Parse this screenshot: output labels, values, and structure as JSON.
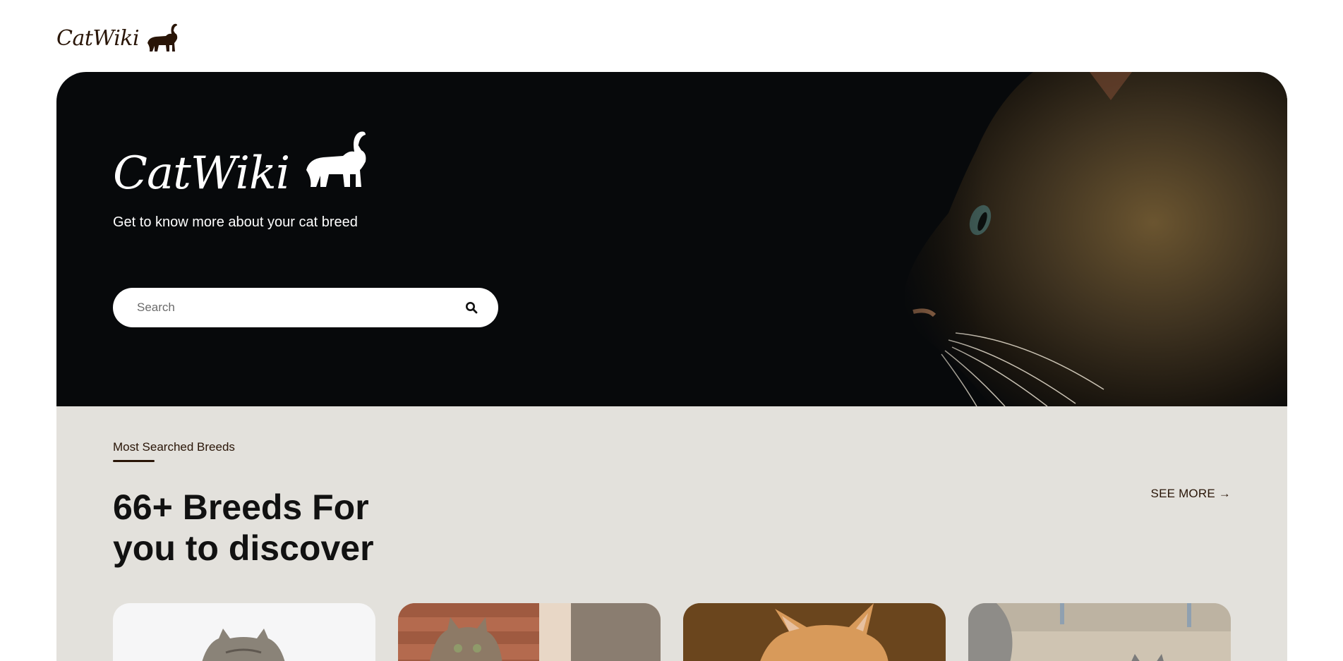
{
  "header": {
    "logo_text": "CatWiki",
    "logo_icon": "cat-silhouette-icon",
    "brand_color": "#291507"
  },
  "hero": {
    "logo_text": "CatWiki",
    "logo_icon": "cat-silhouette-icon",
    "tagline": "Get to know more about your cat breed",
    "background": "#07090b",
    "search": {
      "placeholder": "Search",
      "value": "",
      "icon": "search-icon"
    }
  },
  "breeds_section": {
    "label": "Most Searched Breeds",
    "heading": "66+ Breeds For you to discover",
    "see_more": "SEE MORE →",
    "background": "#e3e1dc",
    "cards": [
      {
        "image": "grey-tabby-cat-white-background"
      },
      {
        "image": "tabby-cat-brick-wall"
      },
      {
        "image": "orange-fluffy-cat"
      },
      {
        "image": "grey-fluffy-cat-outdoors"
      }
    ]
  }
}
